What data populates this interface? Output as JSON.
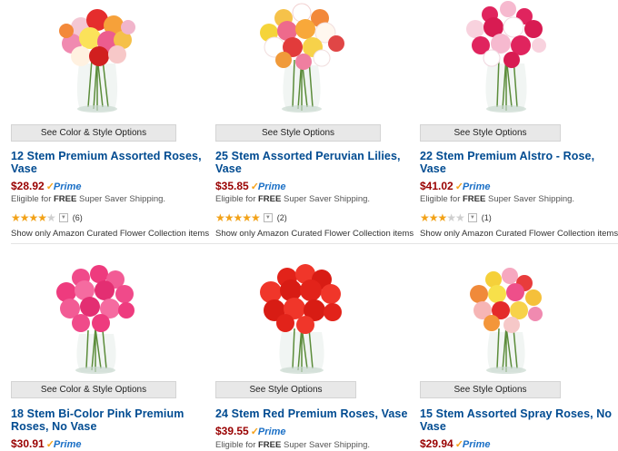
{
  "products": [
    {
      "option_label": "See Color & Style Options",
      "title": "12 Stem Premium Assorted Roses, Vase",
      "price": "$28.92",
      "prime": "Prime",
      "shipping_prefix": "Eligible for ",
      "shipping_bold": "FREE",
      "shipping_suffix": " Super Saver Shipping.",
      "rating_stars": 4,
      "review_count": "(6)",
      "curated": "Show only Amazon Curated Flower Collection items",
      "bouquet": "assorted-roses-icon"
    },
    {
      "option_label": "See Style Options",
      "title": "25 Stem Assorted Peruvian Lilies, Vase",
      "price": "$35.85",
      "prime": "Prime",
      "shipping_prefix": "Eligible for ",
      "shipping_bold": "FREE",
      "shipping_suffix": " Super Saver Shipping.",
      "rating_stars": 5,
      "review_count": "(2)",
      "curated": "Show only Amazon Curated Flower Collection items",
      "bouquet": "peruvian-lilies-icon"
    },
    {
      "option_label": "See Style Options",
      "title": "22 Stem Premium Alstro - Rose, Vase",
      "price": "$41.02",
      "prime": "Prime",
      "shipping_prefix": "Eligible for ",
      "shipping_bold": "FREE",
      "shipping_suffix": " Super Saver Shipping.",
      "rating_stars": 3,
      "review_count": "(1)",
      "curated": "Show only Amazon Curated Flower Collection items",
      "bouquet": "alstro-rose-icon"
    },
    {
      "option_label": "See Color & Style Options",
      "title": "18 Stem Bi-Color Pink Premium Roses, No Vase",
      "price": "$30.91",
      "prime": "Prime",
      "bouquet": "pink-roses-icon"
    },
    {
      "option_label": "See Style Options",
      "title": "24 Stem Red Premium Roses, Vase",
      "price": "$39.55",
      "prime": "Prime",
      "shipping_prefix": "Eligible for ",
      "shipping_bold": "FREE",
      "shipping_suffix": " Super Saver Shipping.",
      "bouquet": "red-roses-icon"
    },
    {
      "option_label": "See Style Options",
      "title": "15 Stem Assorted Spray Roses, No Vase",
      "price": "$29.94",
      "prime": "Prime",
      "bouquet": "spray-roses-icon"
    }
  ],
  "colors": {
    "title_link": "#004b91",
    "price": "#990000",
    "prime_blue": "#1a6fc6",
    "prime_check": "#f6a21a",
    "star_on": "#f2a218",
    "star_off": "#cfcfcf"
  }
}
